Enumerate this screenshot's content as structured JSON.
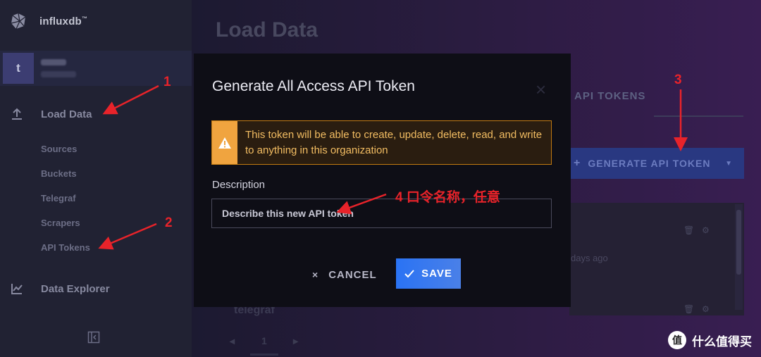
{
  "sidebar": {
    "brand": "influxdb",
    "brand_tm": "™",
    "avatar_letter": "t",
    "nav": {
      "load_data": "Load Data",
      "sources": "Sources",
      "buckets": "Buckets",
      "telegraf": "Telegraf",
      "scrapers": "Scrapers",
      "api_tokens": "API Tokens",
      "data_explorer": "Data Explorer"
    }
  },
  "page": {
    "title": "Load Data",
    "tab_api_tokens": "API TOKENS",
    "generate_button": "GENERATE API TOKEN",
    "row_time": "days ago",
    "row_name": "telegraf",
    "pager_current": "1"
  },
  "modal": {
    "title": "Generate All Access API Token",
    "close": "×",
    "warning": "This token will be able to create, update, delete, read, and write to anything in this organization",
    "description_label": "Description",
    "description_placeholder": "Describe this new API token",
    "cancel_label": "CANCEL",
    "save_label": "SAVE"
  },
  "annotations": {
    "n1": "1",
    "n2": "2",
    "n3": "3",
    "n4": "4 口令名称，任意",
    "color": "#e8232a"
  },
  "watermark": {
    "text": "什么值得买",
    "badge": "值"
  }
}
